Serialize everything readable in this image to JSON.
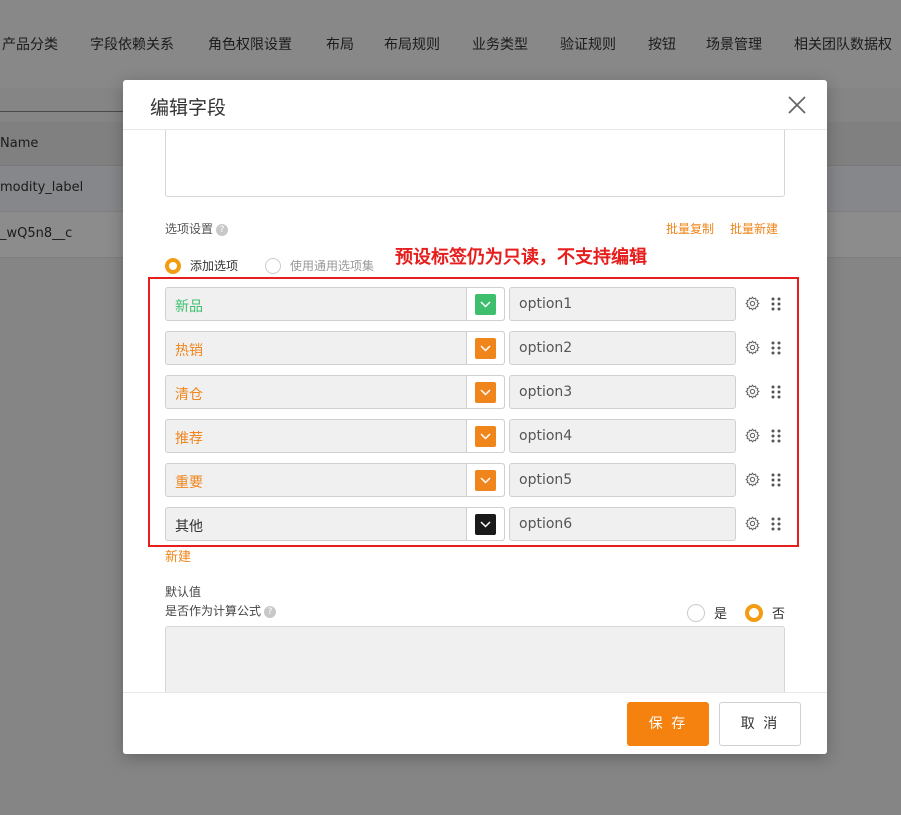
{
  "background": {
    "tabs": [
      "产品分类",
      "字段依赖关系",
      "角色权限设置",
      "布局",
      "布局规则",
      "业务类型",
      "验证规则",
      "按钮",
      "场景管理",
      "相关团队数据权"
    ],
    "table_header": "Name",
    "rows": [
      "modity_label",
      "_wQ5n8__c"
    ]
  },
  "modal": {
    "title": "编辑字段",
    "options_section_label": "选项设置",
    "batch_copy": "批量复制",
    "batch_new": "批量新建",
    "radio_add_option": "添加选项",
    "radio_use_common": "使用通用选项集",
    "annotation": "预设标签仍为只读，不支持编辑",
    "options": [
      {
        "label": "新品",
        "value": "option1",
        "color": "#3dbf6e"
      },
      {
        "label": "热销",
        "value": "option2",
        "color": "#f0851c"
      },
      {
        "label": "清仓",
        "value": "option3",
        "color": "#f0851c"
      },
      {
        "label": "推荐",
        "value": "option4",
        "color": "#f0851c"
      },
      {
        "label": "重要",
        "value": "option5",
        "color": "#f0851c"
      },
      {
        "label": "其他",
        "value": "option6",
        "color": "#1a1a1a"
      }
    ],
    "new_link": "新建",
    "default_value_label": "默认值",
    "formula_label": "是否作为计算公式",
    "radio_yes": "是",
    "radio_no": "否",
    "formula_selected": "否",
    "save_label": "保 存",
    "cancel_label": "取 消"
  }
}
